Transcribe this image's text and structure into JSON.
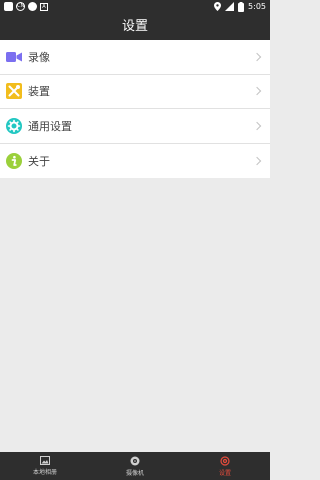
{
  "status_bar": {
    "time": "5:05",
    "icons": [
      "notification-square-icon",
      "cn-icon",
      "dot-icon",
      "a-icon",
      "location-icon",
      "signal-icon",
      "battery-icon"
    ]
  },
  "header": {
    "title": "设置"
  },
  "menu": {
    "items": [
      {
        "label": "录像",
        "icon": "video-camera-icon",
        "color": "#7b6ff0"
      },
      {
        "label": "装置",
        "icon": "tools-icon",
        "color": "#f2bd1d"
      },
      {
        "label": "通用设置",
        "icon": "gear-icon",
        "color": "#21c7c2"
      },
      {
        "label": "关于",
        "icon": "info-icon",
        "color": "#9bd03b"
      }
    ]
  },
  "bottom_nav": {
    "items": [
      {
        "label": "本地相册",
        "icon": "image-icon",
        "active": false
      },
      {
        "label": "摄像机",
        "icon": "camera-lens-icon",
        "active": false
      },
      {
        "label": "设置",
        "icon": "settings-icon",
        "active": true
      }
    ],
    "active_color": "#e74c3c"
  }
}
